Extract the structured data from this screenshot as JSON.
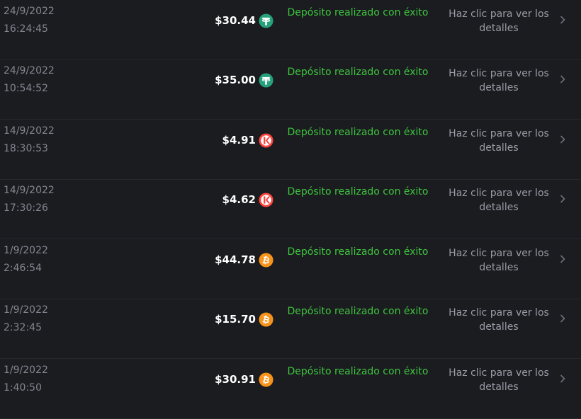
{
  "rows": [
    {
      "date": "24/9/2022",
      "time": "16:24:45",
      "amount": "$30.44",
      "coin": "tether-icon",
      "status": "Depósito realizado con éxito",
      "details": "Haz clic para ver los detalles"
    },
    {
      "date": "24/9/2022",
      "time": "10:54:52",
      "amount": "$35.00",
      "coin": "tether-icon",
      "status": "Depósito realizado con éxito",
      "details": "Haz clic para ver los detalles"
    },
    {
      "date": "14/9/2022",
      "time": "18:30:53",
      "amount": "$4.91",
      "coin": "kava-icon",
      "status": "Depósito realizado con éxito",
      "details": "Haz clic para ver los detalles"
    },
    {
      "date": "14/9/2022",
      "time": "17:30:26",
      "amount": "$4.62",
      "coin": "kava-icon",
      "status": "Depósito realizado con éxito",
      "details": "Haz clic para ver los detalles"
    },
    {
      "date": "1/9/2022",
      "time": "2:46:54",
      "amount": "$44.78",
      "coin": "bitcoin-icon",
      "status": "Depósito realizado con éxito",
      "details": "Haz clic para ver los detalles"
    },
    {
      "date": "1/9/2022",
      "time": "2:32:45",
      "amount": "$15.70",
      "coin": "bitcoin-icon",
      "status": "Depósito realizado con éxito",
      "details": "Haz clic para ver los detalles"
    },
    {
      "date": "1/9/2022",
      "time": "1:40:50",
      "amount": "$30.91",
      "coin": "bitcoin-icon",
      "status": "Depósito realizado con éxito",
      "details": "Haz clic para ver los detalles"
    }
  ],
  "colors": {
    "background": "#1b1c20",
    "success": "#3ec43e",
    "tether": "#26a17b",
    "kava": "#ff433e",
    "bitcoin": "#f7931a"
  }
}
